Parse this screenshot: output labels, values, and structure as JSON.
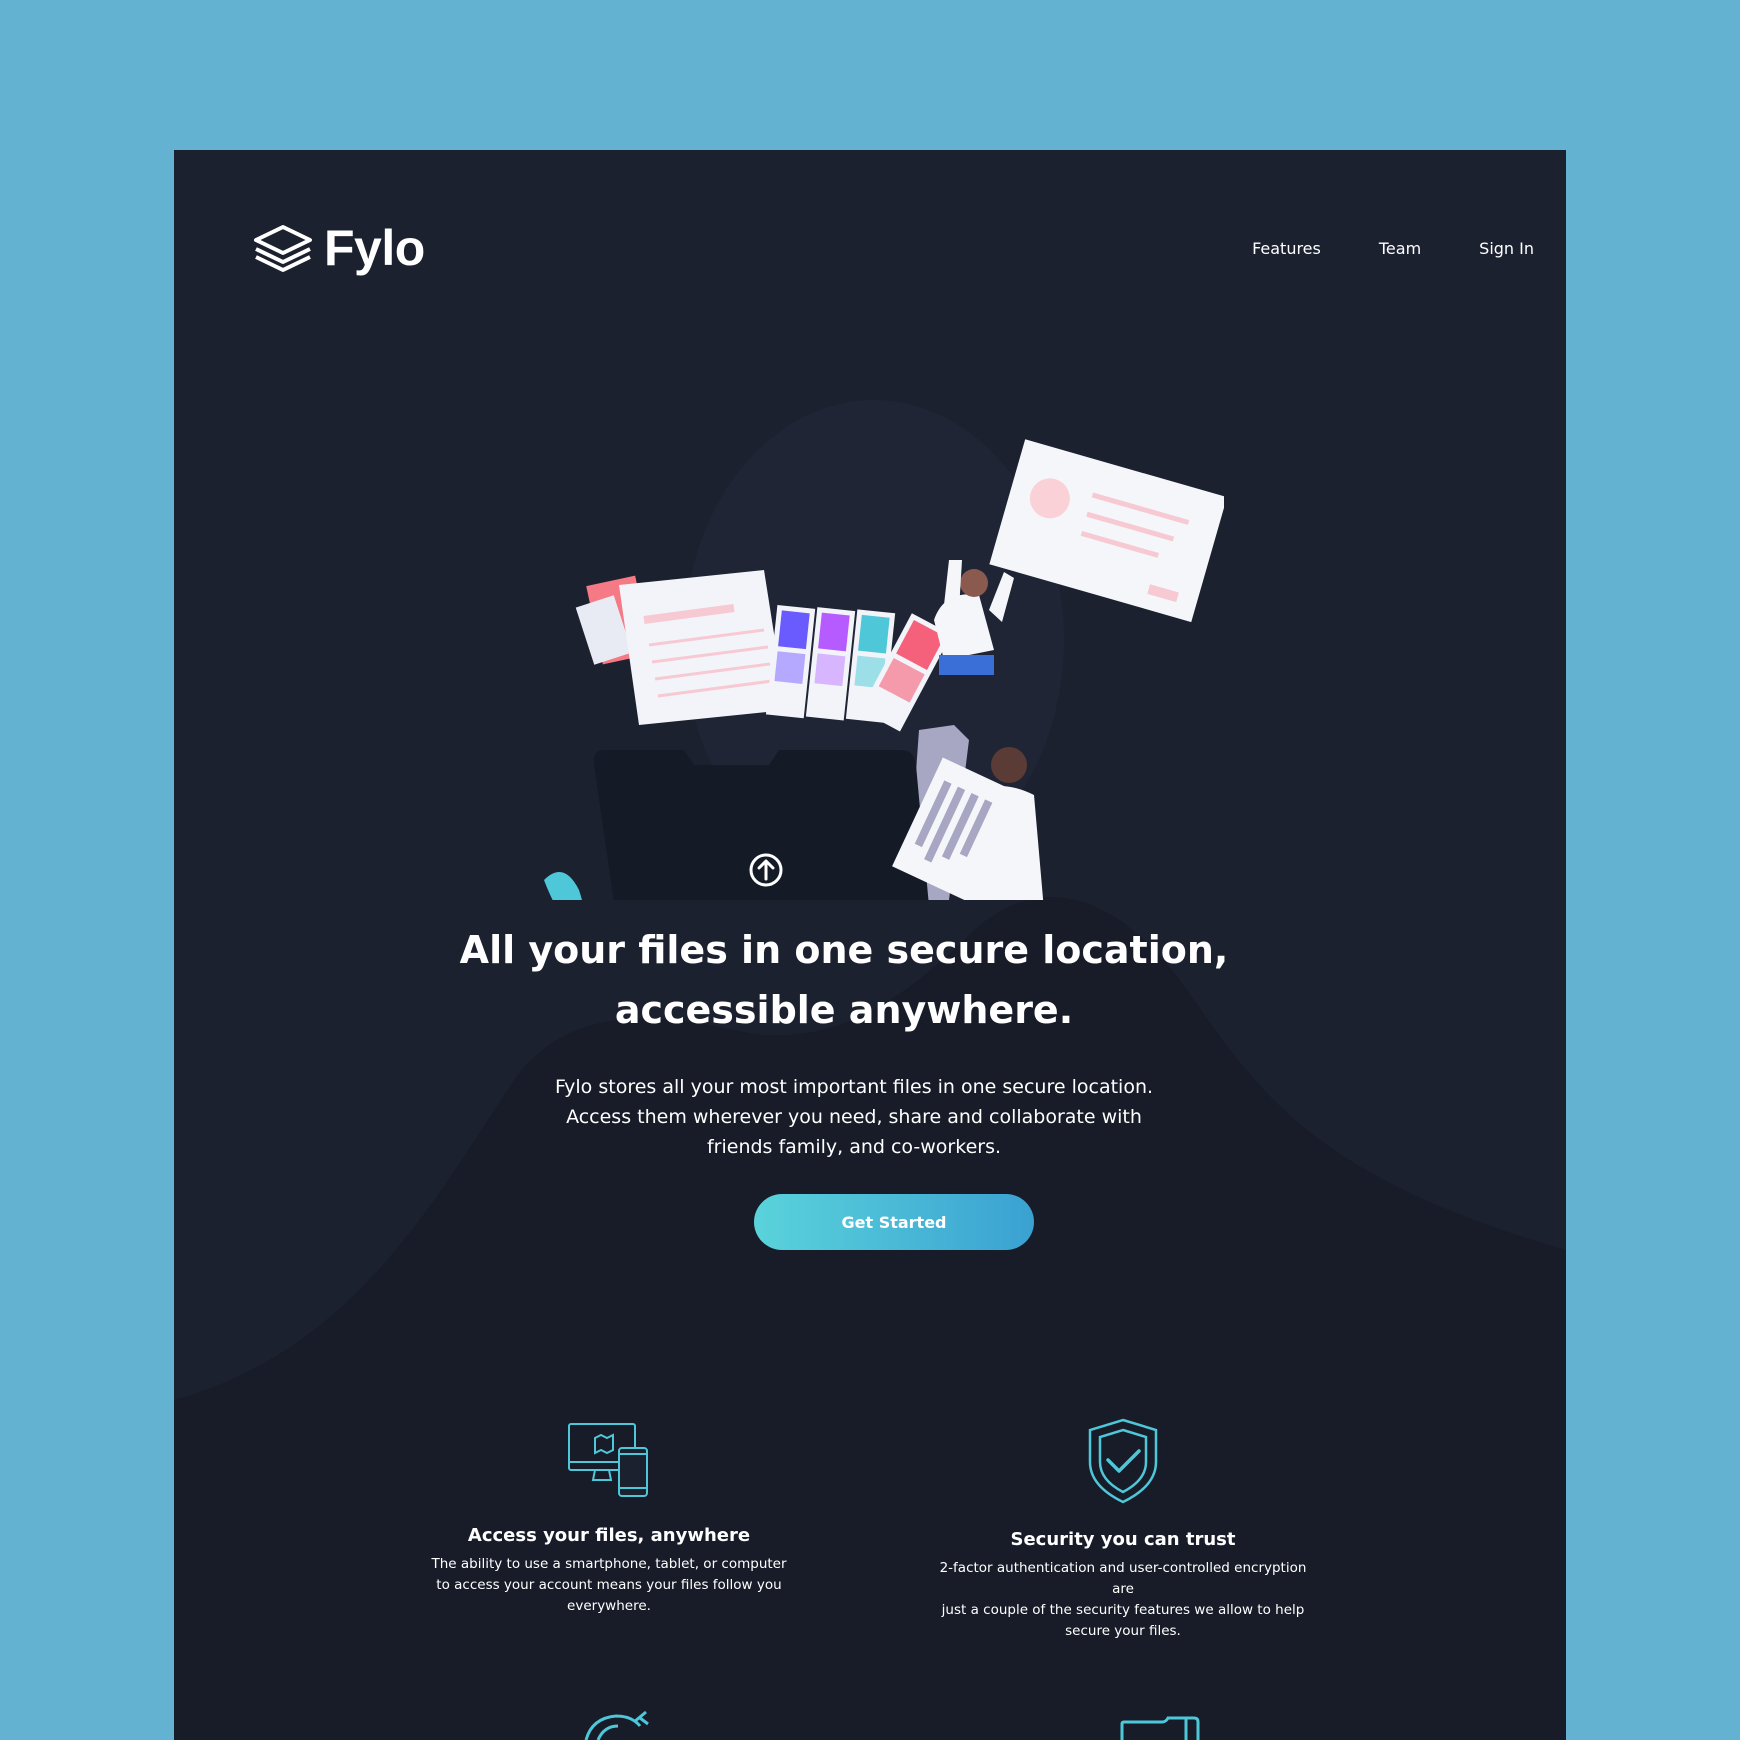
{
  "brand": {
    "name": "Fylo",
    "accent": "#5ad3db",
    "accent_dark": "#3aa1d2",
    "background": "#1c2130",
    "page_background": "#63b2d1"
  },
  "nav": {
    "links": [
      "Features",
      "Team",
      "Sign In"
    ]
  },
  "hero": {
    "headline_line1": "All your files in one secure location,",
    "headline_line2": "accessible anywhere.",
    "subtext_line1": "Fylo stores all your most important files in one secure location.",
    "subtext_line2": "Access them wherever you need, share and collaborate with",
    "subtext_line3": "friends family, and co-workers.",
    "cta_label": "Get Started"
  },
  "features": [
    {
      "icon": "devices-icon",
      "title": "Access your files, anywhere",
      "desc_line1": "The ability to use a smartphone, tablet, or computer",
      "desc_line2": "to access your account means your files follow you",
      "desc_line3": "everywhere."
    },
    {
      "icon": "shield-check-icon",
      "title": "Security you can trust",
      "desc_line1": "2-factor authentication and user-controlled encryption are",
      "desc_line2": "just a couple of the security features we allow to help",
      "desc_line3": "secure your files."
    }
  ]
}
